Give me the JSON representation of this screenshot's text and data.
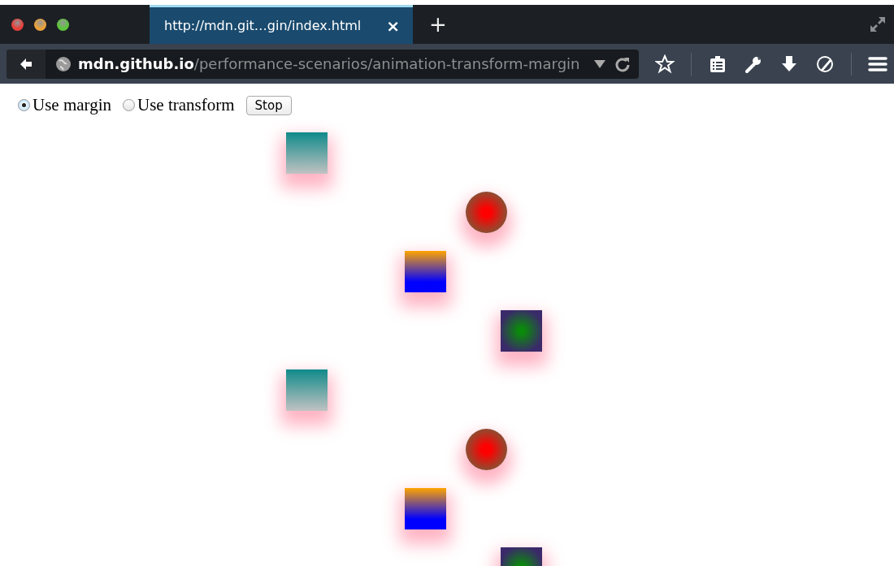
{
  "tab": {
    "title": "http://mdn.git…gin/index.html",
    "close": "×",
    "selected": true
  },
  "new_tab": "+",
  "url": {
    "host": "mdn.github.io",
    "path": "/performance-scenarios/animation-transform-margin"
  },
  "options": [
    {
      "label": "Use margin",
      "selected": true
    },
    {
      "label": "Use transform",
      "selected": false
    }
  ],
  "stop_button": "Stop",
  "shapes": [
    {
      "kind": "teal"
    },
    {
      "kind": "red"
    },
    {
      "kind": "orange"
    },
    {
      "kind": "green"
    },
    {
      "kind": "teal"
    },
    {
      "kind": "red"
    },
    {
      "kind": "orange"
    },
    {
      "kind": "green"
    }
  ]
}
